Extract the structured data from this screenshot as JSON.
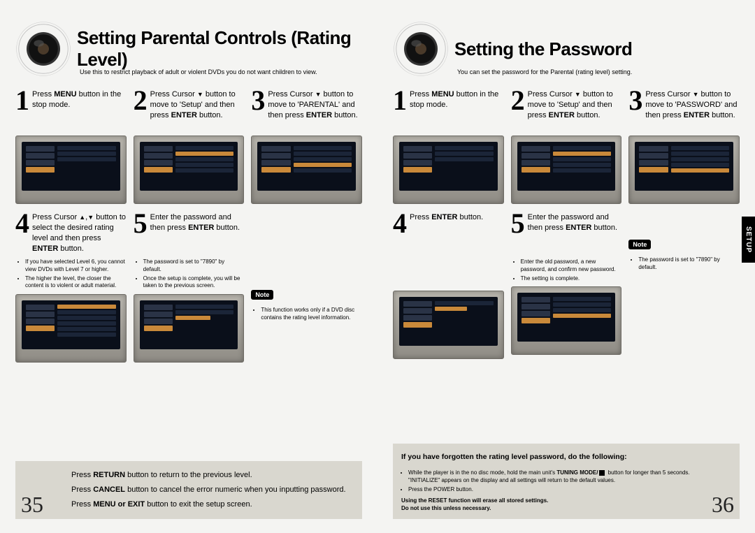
{
  "left": {
    "title": "Setting Parental Controls (Rating Level)",
    "subtitle": "Use this to restrict playback of adult or violent DVDs you do not want children to view.",
    "steps": {
      "s1": {
        "num": "1",
        "text": "Press <b>MENU</b> button in the stop mode."
      },
      "s2": {
        "num": "2",
        "text": "Press Cursor <span class='arrow'>▼</span> button to move to 'Setup' and then press <b>ENTER</b> button."
      },
      "s3": {
        "num": "3",
        "text": "Press Cursor <span class='arrow'>▼</span> button to move to 'PARENTAL' and then press <b>ENTER</b> button."
      },
      "s4": {
        "num": "4",
        "text": "Press Cursor <span class='arrow'>▲</span>,<span class='arrow'>▼</span> button to select the desired rating level and then press <b>ENTER</b> button."
      },
      "s5": {
        "num": "5",
        "text": "Enter the password and then press <b>ENTER</b> button."
      }
    },
    "bullets4": [
      "If you have selected Level 6, you cannot view DVDs with Level 7 or higher.",
      "The higher the level, the closer the content is to violent or adult material."
    ],
    "bullets5": [
      "The password is set to \"7890\" by default.",
      "Once the setup is complete, you will be taken to the previous screen."
    ],
    "note_label": "Note",
    "note_bullet": "This function works only if a DVD disc contains the rating level information.",
    "footer": {
      "l1": "Press <b>RETURN</b> button to return to the previous level.",
      "l2": "Press <b>CANCEL</b> button to cancel the error numeric when you inputting password.",
      "l3": "Press <b>MENU or EXIT</b> button to exit the setup screen."
    },
    "page_num": "35"
  },
  "right": {
    "title": "Setting the Password",
    "subtitle": "You can set the password for the Parental (rating level) setting.",
    "steps": {
      "s1": {
        "num": "1",
        "text": "Press <b>MENU</b> button in the stop mode."
      },
      "s2": {
        "num": "2",
        "text": "Press Cursor <span class='arrow'>▼</span> button to move to 'Setup' and then press <b>ENTER</b> button."
      },
      "s3": {
        "num": "3",
        "text": "Press Cursor <span class='arrow'>▼</span> button to move to 'PASSWORD' and then press <b>ENTER</b> button."
      },
      "s4": {
        "num": "4",
        "text": "Press <b>ENTER</b> button."
      },
      "s5": {
        "num": "5",
        "text": "Enter the password and then press <b>ENTER</b> button."
      }
    },
    "bullets5": [
      "Enter the old password, a new password, and confirm new password.",
      "The setting is complete."
    ],
    "note_label": "Note",
    "note_bullet": "The password is set to \"7890\" by default.",
    "side_tab": "SETUP",
    "footer": {
      "title": "If you have forgotten the rating level password, do the following:",
      "b1_a": "While the player is in the no disc mode, hold the main unit's ",
      "b1_b": "TUNING MODE/",
      "b1_c": " button for longer than 5 seconds. \"INITIALIZE\" appears on the display and all settings will return to the default values.",
      "b2": "Press the POWER button.",
      "warn1": "Using the RESET function will erase all stored settings.",
      "warn2": "Do not use this unless necessary."
    },
    "page_num": "36"
  }
}
